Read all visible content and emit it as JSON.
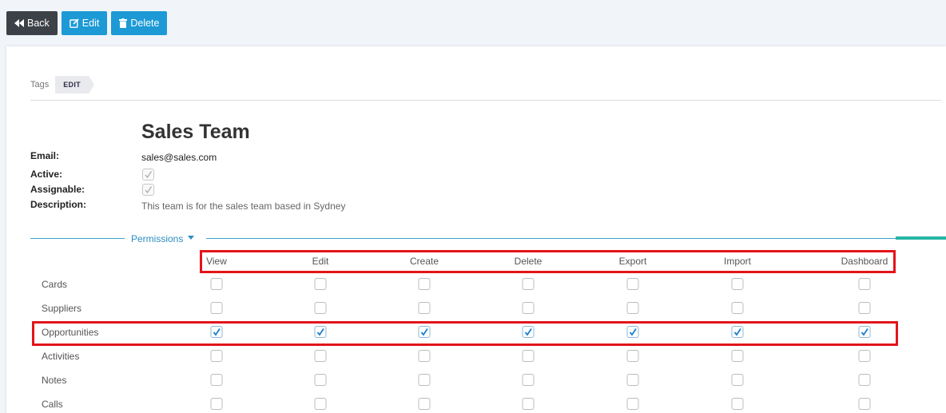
{
  "toolbar": {
    "back_label": "Back",
    "edit_label": "Edit",
    "delete_label": "Delete"
  },
  "breadcrumb": {
    "tags": "Tags",
    "current": "EDIT"
  },
  "team": {
    "name": "Sales Team",
    "email_label": "Email:",
    "email": "sales@sales.com",
    "active_label": "Active:",
    "active": true,
    "assignable_label": "Assignable:",
    "assignable": true,
    "description_label": "Description:",
    "description": "This team is for the sales team based in Sydney"
  },
  "permissions": {
    "section_label": "Permissions",
    "columns": [
      "View",
      "Edit",
      "Create",
      "Delete",
      "Export",
      "Import",
      "Dashboard"
    ],
    "rows": [
      {
        "label": "Cards",
        "values": [
          false,
          false,
          false,
          false,
          false,
          false,
          false
        ]
      },
      {
        "label": "Suppliers",
        "values": [
          false,
          false,
          false,
          false,
          false,
          false,
          false
        ]
      },
      {
        "label": "Opportunities",
        "values": [
          true,
          true,
          true,
          true,
          true,
          true,
          true
        ]
      },
      {
        "label": "Activities",
        "values": [
          false,
          false,
          false,
          false,
          false,
          false,
          false
        ]
      },
      {
        "label": "Notes",
        "values": [
          false,
          false,
          false,
          false,
          false,
          false,
          false
        ]
      },
      {
        "label": "Calls",
        "values": [
          false,
          false,
          false,
          false,
          false,
          false,
          false
        ]
      }
    ]
  },
  "colors": {
    "accent_blue": "#1d9ad6",
    "highlight_red": "#e3141a",
    "check_blue": "#1a7fcf"
  }
}
